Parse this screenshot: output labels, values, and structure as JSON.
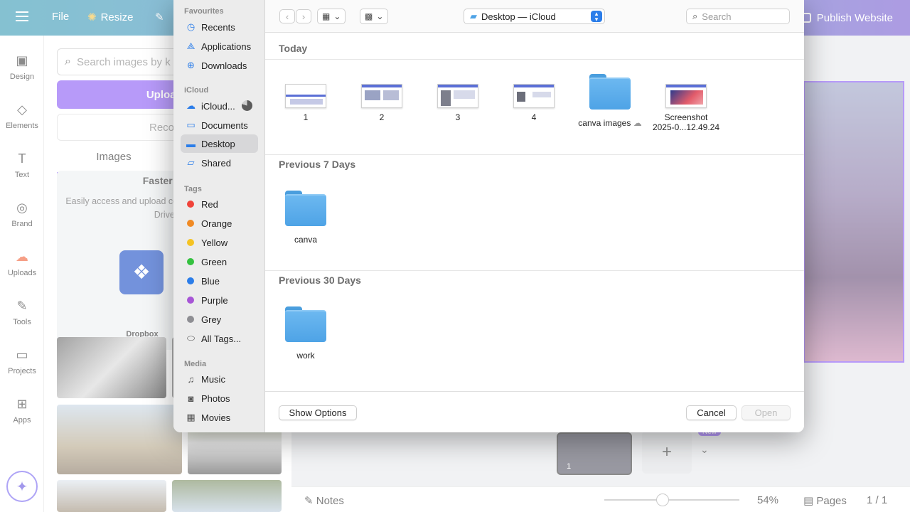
{
  "canva": {
    "menu": {
      "file": "File",
      "resize": "Resize"
    },
    "publish_label": "Publish Website",
    "rail": [
      {
        "label": "Design",
        "icon": "design-icon"
      },
      {
        "label": "Elements",
        "icon": "elements-icon"
      },
      {
        "label": "Text",
        "icon": "text-icon"
      },
      {
        "label": "Brand",
        "icon": "brand-icon"
      },
      {
        "label": "Uploads",
        "icon": "uploads-icon"
      },
      {
        "label": "Tools",
        "icon": "tools-icon"
      },
      {
        "label": "Projects",
        "icon": "projects-icon"
      },
      {
        "label": "Apps",
        "icon": "apps-icon"
      }
    ],
    "panel": {
      "search_placeholder": "Search images by k",
      "upload_label": "Upload fil",
      "record_label": "Record y",
      "tab_images": "Images",
      "card_heading": "Faster medi",
      "card_desc": "Easily access and upload connecting your Canva acc Drive an",
      "dropbox_label": "Dropbox"
    },
    "bottom": {
      "notes": "Notes",
      "zoom": "54%",
      "pages": "Pages",
      "page_count": "1 / 1",
      "new_badge": "New",
      "thumb_page": "1"
    }
  },
  "dialog": {
    "location": "Desktop — iCloud",
    "search_placeholder": "Search",
    "sidebar": {
      "favourites_heading": "Favourites",
      "favourites": [
        {
          "label": "Recents",
          "icon": "clock-icon"
        },
        {
          "label": "Applications",
          "icon": "applications-icon"
        },
        {
          "label": "Downloads",
          "icon": "download-icon"
        }
      ],
      "icloud_heading": "iCloud",
      "icloud": [
        {
          "label": "iCloud...",
          "icon": "cloud-icon"
        },
        {
          "label": "Documents",
          "icon": "document-icon"
        },
        {
          "label": "Desktop",
          "icon": "desktop-icon",
          "selected": true
        },
        {
          "label": "Shared",
          "icon": "shared-folder-icon"
        }
      ],
      "tags_heading": "Tags",
      "tags": [
        {
          "label": "Red",
          "color": "#f0433a"
        },
        {
          "label": "Orange",
          "color": "#f08a24"
        },
        {
          "label": "Yellow",
          "color": "#f5c323"
        },
        {
          "label": "Green",
          "color": "#34c13f"
        },
        {
          "label": "Blue",
          "color": "#2b7de9"
        },
        {
          "label": "Purple",
          "color": "#a755d6"
        },
        {
          "label": "Grey",
          "color": "#8e8e93"
        }
      ],
      "all_tags": "All Tags...",
      "media_heading": "Media",
      "media": [
        {
          "label": "Music",
          "icon": "music-icon"
        },
        {
          "label": "Photos",
          "icon": "photos-icon"
        },
        {
          "label": "Movies",
          "icon": "movies-icon"
        }
      ]
    },
    "sections": {
      "today": {
        "heading": "Today",
        "files": [
          {
            "label": "1",
            "kind": "screenshot"
          },
          {
            "label": "2",
            "kind": "screenshot"
          },
          {
            "label": "3",
            "kind": "screenshot"
          },
          {
            "label": "4",
            "kind": "screenshot"
          },
          {
            "label": "canva images",
            "kind": "folder"
          },
          {
            "label": "Screenshot",
            "label2": "2025-0...12.49.24",
            "kind": "screenshot"
          }
        ]
      },
      "prev7": {
        "heading": "Previous 7 Days",
        "files": [
          {
            "label": "canva",
            "kind": "folder"
          }
        ]
      },
      "prev30": {
        "heading": "Previous 30 Days",
        "files": [
          {
            "label": "work",
            "kind": "folder"
          }
        ]
      }
    },
    "buttons": {
      "show_options": "Show Options",
      "cancel": "Cancel",
      "open": "Open"
    }
  }
}
